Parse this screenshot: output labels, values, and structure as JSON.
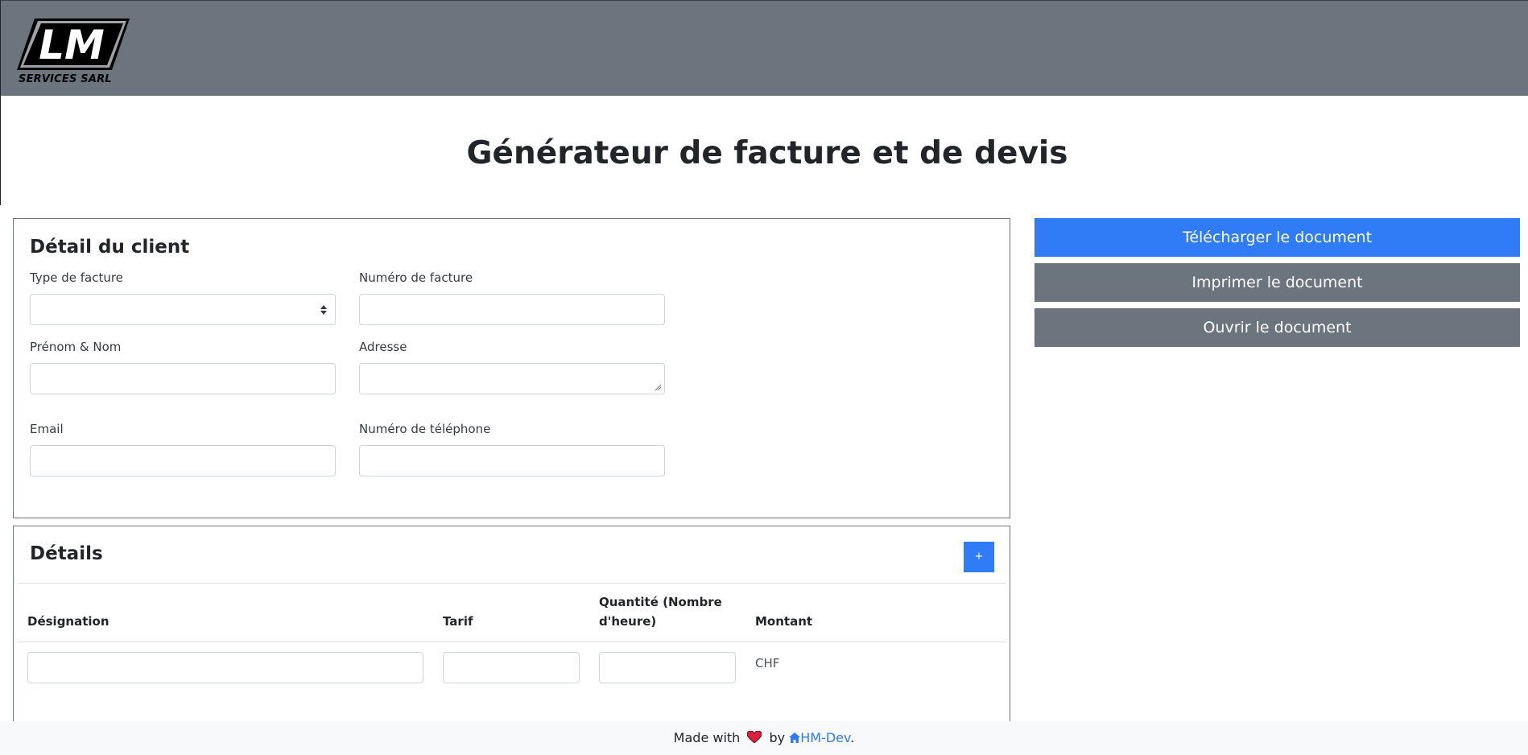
{
  "header": {
    "logo_letters": "LM",
    "logo_subtitle": "SERVICES SARL"
  },
  "page_title": "Générateur de facture et de devis",
  "client_card": {
    "title": "Détail du client",
    "fields": {
      "invoice_type": {
        "label": "Type de facture",
        "value": ""
      },
      "invoice_number": {
        "label": "Numéro de facture",
        "value": ""
      },
      "full_name": {
        "label": "Prénom & Nom",
        "value": ""
      },
      "address": {
        "label": "Adresse",
        "value": ""
      },
      "email": {
        "label": "Email",
        "value": ""
      },
      "phone": {
        "label": "Numéro de téléphone",
        "value": ""
      }
    }
  },
  "details_card": {
    "title": "Détails",
    "add_label": "+",
    "columns": {
      "designation": "Désignation",
      "rate": "Tarif",
      "quantity_line1": "Quantité (Nombre",
      "quantity_line2": "d'heure)",
      "amount": "Montant"
    },
    "rows": [
      {
        "designation": "",
        "rate": "",
        "quantity": "",
        "amount": "CHF"
      }
    ]
  },
  "actions": {
    "download": "Télécharger le document",
    "print": "Imprimer le document",
    "open": "Ouvrir le document"
  },
  "footer": {
    "made_with": "Made with",
    "by": "by",
    "author": "HM-Dev",
    "period": "."
  },
  "colors": {
    "header_bg": "#6c757d",
    "primary": "#2f7cf6",
    "secondary": "#6c757d"
  }
}
